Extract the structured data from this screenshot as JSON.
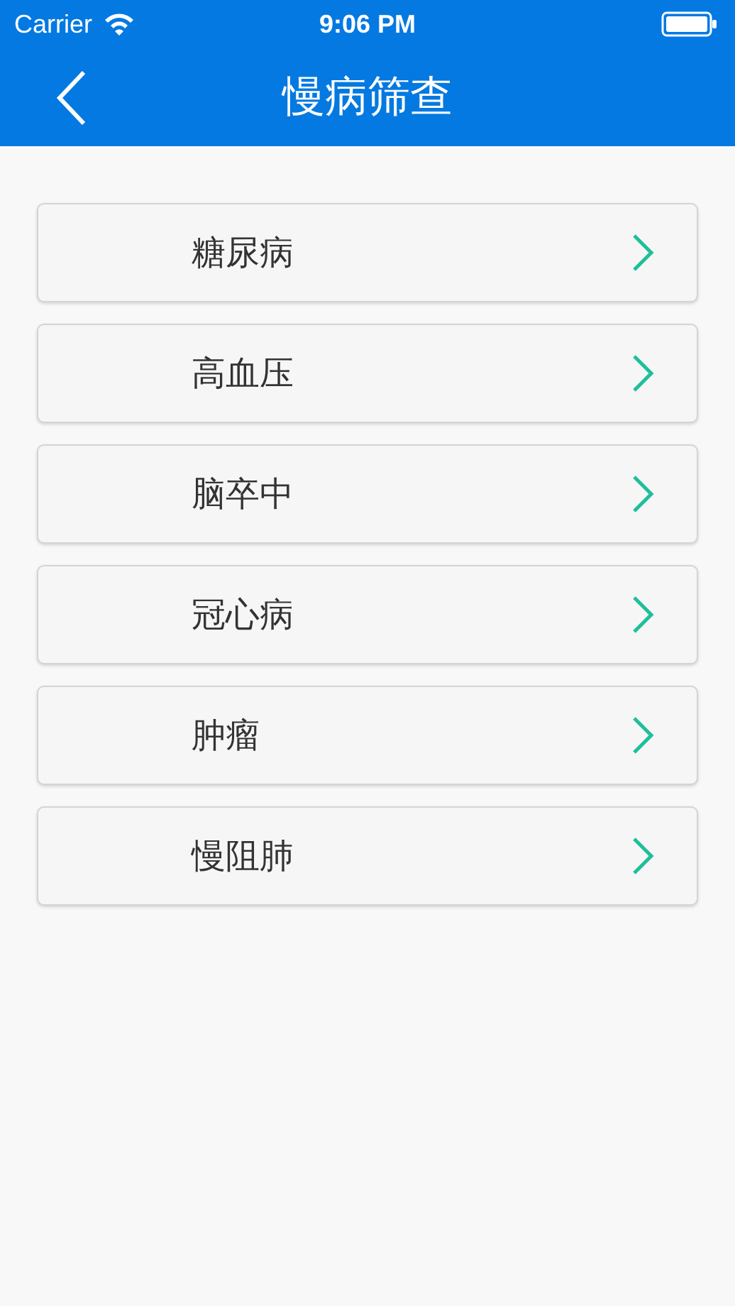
{
  "status_bar": {
    "carrier": "Carrier",
    "time": "9:06 PM"
  },
  "nav_bar": {
    "title": "慢病筛查"
  },
  "items": [
    {
      "label": "糖尿病"
    },
    {
      "label": "高血压"
    },
    {
      "label": "脑卒中"
    },
    {
      "label": "冠心病"
    },
    {
      "label": "肿瘤"
    },
    {
      "label": "慢阻肺"
    }
  ]
}
